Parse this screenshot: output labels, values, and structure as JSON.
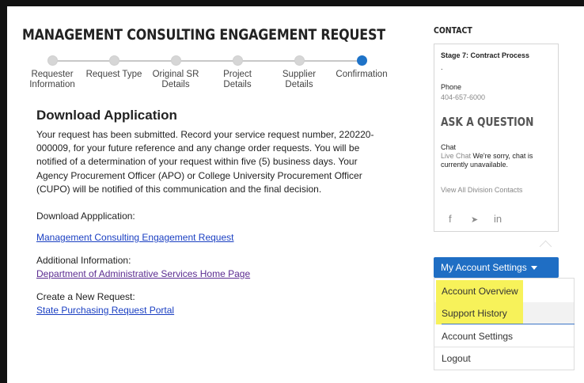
{
  "page": {
    "title": "MANAGEMENT CONSULTING ENGAGEMENT REQUEST"
  },
  "stepper": {
    "steps": [
      {
        "label": "Requester\nInformation",
        "state": "complete"
      },
      {
        "label": "Request Type",
        "state": "complete"
      },
      {
        "label": "Original SR\nDetails",
        "state": "complete"
      },
      {
        "label": "Project\nDetails",
        "state": "complete"
      },
      {
        "label": "Supplier\nDetails",
        "state": "complete"
      },
      {
        "label": "Confirmation",
        "state": "active"
      }
    ],
    "active_color": "#1e73c8"
  },
  "main": {
    "section_title": "Download Application",
    "message": "Your request has been submitted. Record your service request number, 220220-000009, for your future reference and any change order requests. You will be notified of a determination of your request within five (5) business days. Your Agency Procurement Officer (APO) or College University Procurement Officer (CUPO) will be notified of this communication and the final decision.",
    "download_label": "Download Appplication:",
    "download_link": "Management Consulting Engagement Request",
    "additional_label": "Additional Information:",
    "additional_link": "Department of Administrative Services Home Page",
    "new_request_label": "Create a New Request:",
    "new_request_link": "State Purchasing Request Portal",
    "link_color": "#1a3fc2"
  },
  "contact": {
    "heading": "CONTACT",
    "stage": "Stage 7: Contract Process",
    "dot": ".",
    "phone_label": "Phone",
    "phone": "404-657-6000",
    "ask_heading": "ASK A QUESTION",
    "chat_label": "Chat",
    "chat_link": "Live Chat",
    "chat_status": " We're sorry, chat is currently unavailable.",
    "view_all": "View All Division Contacts",
    "social": [
      {
        "icon": "facebook-icon",
        "glyph": "f"
      },
      {
        "icon": "twitter-icon",
        "glyph": "➤"
      },
      {
        "icon": "linkedin-icon",
        "glyph": "in"
      }
    ]
  },
  "account": {
    "button_label": "My Account Settings",
    "button_color": "#1f6ec4",
    "items": [
      {
        "label": "Account Overview",
        "highlighted": true
      },
      {
        "label": "Support History",
        "highlighted": true
      },
      {
        "label": "Account Settings",
        "highlighted": false
      },
      {
        "label": "Logout",
        "highlighted": false
      }
    ],
    "highlight_color": "#f7f25a"
  }
}
